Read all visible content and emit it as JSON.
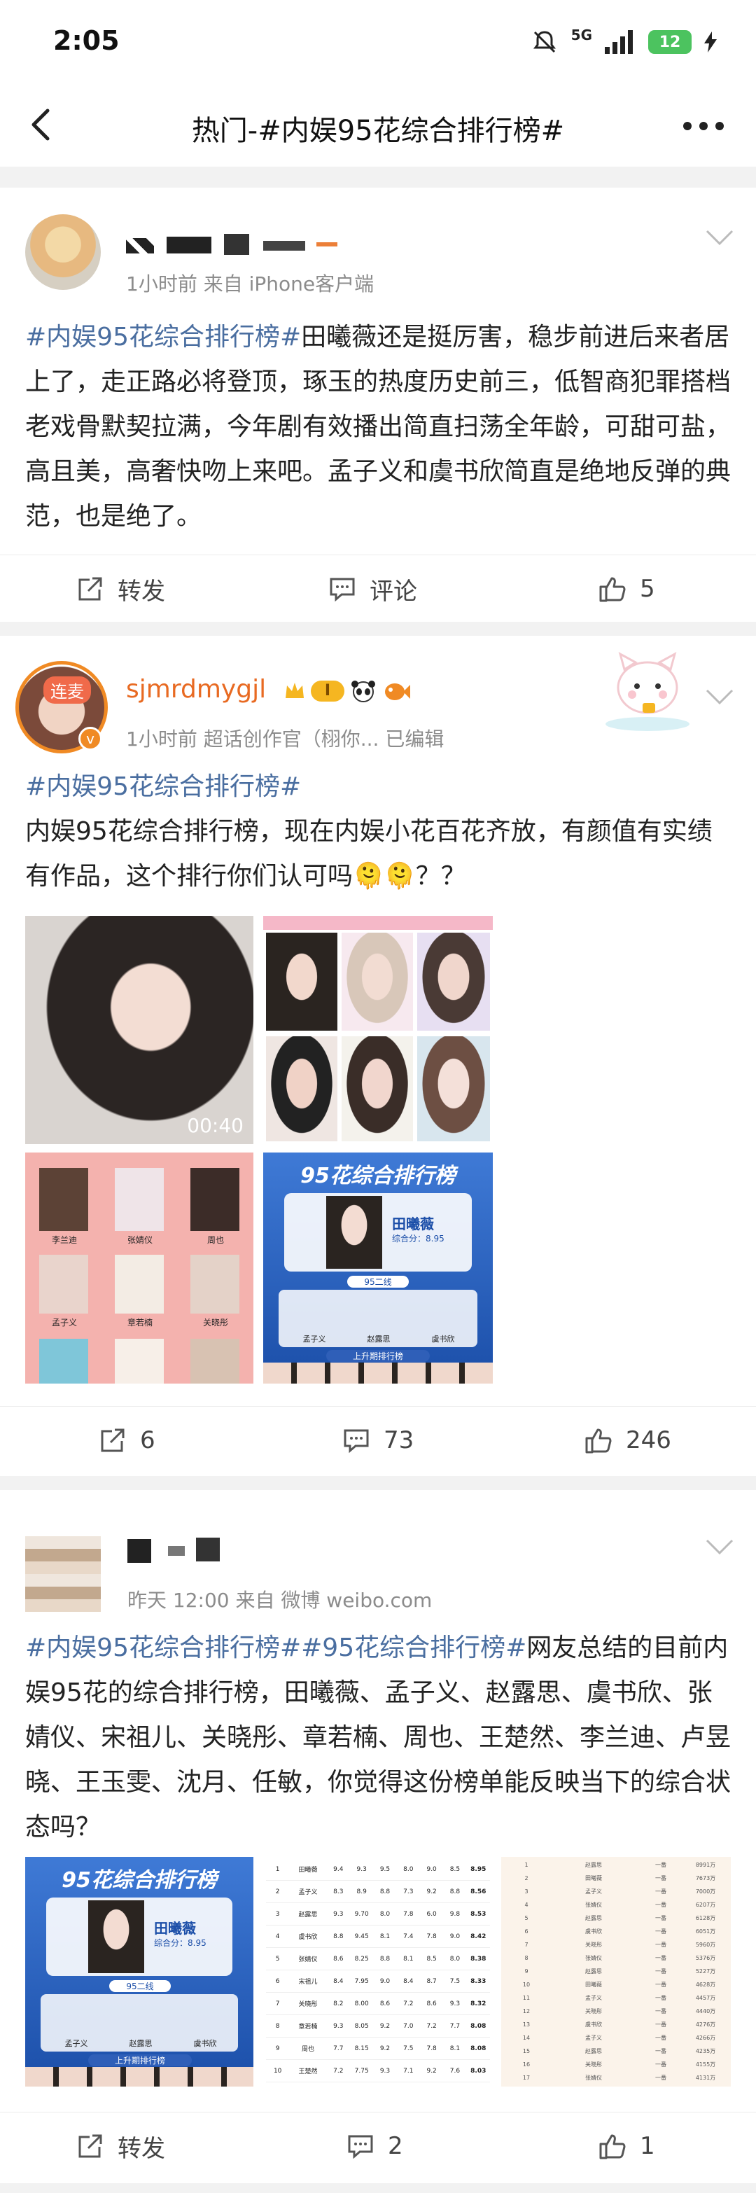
{
  "status": {
    "time": "2:05",
    "network": "5G",
    "battery": "12"
  },
  "nav": {
    "title": "热门-#内娱95花综合排行榜#"
  },
  "posts": [
    {
      "meta": "1小时前  来自 iPhone客户端",
      "text": {
        "tag": "#内娱95花综合排行榜#",
        "body": "田曦薇还是挺厉害，稳步前进后来者居上了，走正路必将登顶，琢玉的热度历史前三，低智商犯罪搭档老戏骨默契拉满，今年剧有效播出简直扫荡全年龄，可甜可盐，高且美，高奢快吻上来吧。孟子义和虞书欣简直是绝地反弹的典范，也是绝了。"
      },
      "actions": {
        "repost": "转发",
        "comment": "评论",
        "like": "5"
      }
    },
    {
      "username": "sjmrdmygjl",
      "avatar_badge": "连麦",
      "level_badge": "I",
      "meta": "1小时前  超话创作官（栩你...  已编辑",
      "text": {
        "tag": "#内娱95花综合排行榜#",
        "body": "内娱95花综合排行榜，现在内娱小花百花齐放，有颜值有实绩有作品，这个排行你们认可吗🫠🫠？？"
      },
      "images": {
        "video_duration": "00:40",
        "ranking_title": "95花综合排行榜",
        "ranking_top_name": "田曦薇",
        "ranking_top_score": "综合分：8.95",
        "ranking_tier": "95二线",
        "ranking_second_row": [
          "孟子义",
          "赵露思",
          "虞书欣"
        ],
        "ranking_footer": "上升期排行榜",
        "grid_names": [
          "李兰迪",
          "张婧仪",
          "周也",
          "孟子义",
          "章若楠",
          "关晓彤"
        ]
      },
      "actions": {
        "repost": "6",
        "comment": "73",
        "like": "246"
      }
    },
    {
      "meta": "昨天 12:00  来自 微博 weibo.com",
      "text": {
        "tags": "#内娱95花综合排行榜##95花综合排行榜#",
        "body": "网友总结的目前内娱95花的综合排行榜，田曦薇、孟子义、赵露思、虞书欣、张婧仪、宋祖儿、关晓彤、章若楠、周也、王楚然、李兰迪、卢昱晓、王玉雯、沈月、任敏，你觉得这份榜单能反映当下的综合状态吗？"
      },
      "images": {
        "ranking_title": "95花综合排行榜",
        "ranking_top_name": "田曦薇",
        "ranking_top_score": "综合分：8.95",
        "ranking_tier": "95二线",
        "ranking_second_row": [
          "孟子义",
          "赵露思",
          "虞书欣"
        ],
        "ranking_footer": "上升期排行榜",
        "table_rows": [
          {
            "rank": "1",
            "name": "田曦薇",
            "scores": [
              "9.4",
              "9.3",
              "9.5",
              "8.0",
              "9.0",
              "8.5"
            ],
            "total": "8.95"
          },
          {
            "rank": "2",
            "name": "孟子义",
            "scores": [
              "8.3",
              "8.9",
              "8.8",
              "7.3",
              "9.2",
              "8.8"
            ],
            "total": "8.56"
          },
          {
            "rank": "3",
            "name": "赵露思",
            "scores": [
              "9.3",
              "9.70",
              "8.0",
              "7.8",
              "6.0",
              "9.8"
            ],
            "total": "8.53"
          },
          {
            "rank": "4",
            "name": "虞书欣",
            "scores": [
              "8.8",
              "9.45",
              "8.1",
              "7.4",
              "7.8",
              "9.0"
            ],
            "total": "8.42"
          },
          {
            "rank": "5",
            "name": "张婧仪",
            "scores": [
              "8.6",
              "8.25",
              "8.8",
              "8.1",
              "8.5",
              "8.0"
            ],
            "total": "8.38"
          },
          {
            "rank": "6",
            "name": "宋祖儿",
            "scores": [
              "8.4",
              "7.95",
              "9.0",
              "8.4",
              "8.7",
              "7.5"
            ],
            "total": "8.33"
          },
          {
            "rank": "7",
            "name": "关晓彤",
            "scores": [
              "8.2",
              "8.00",
              "8.6",
              "7.2",
              "8.6",
              "9.3"
            ],
            "total": "8.32"
          },
          {
            "rank": "8",
            "name": "章若楠",
            "scores": [
              "9.3",
              "8.05",
              "9.2",
              "7.0",
              "7.2",
              "7.7"
            ],
            "total": "8.08"
          },
          {
            "rank": "9",
            "name": "周也",
            "scores": [
              "7.7",
              "8.15",
              "9.2",
              "7.5",
              "7.8",
              "8.1"
            ],
            "total": "8.08"
          },
          {
            "rank": "10",
            "name": "王楚然",
            "scores": [
              "7.2",
              "7.75",
              "9.3",
              "7.1",
              "9.2",
              "7.6"
            ],
            "total": "8.03"
          }
        ],
        "list_rows": [
          {
            "rank": "1",
            "name": "赵露思",
            "tier": "一番",
            "value": "8991万"
          },
          {
            "rank": "2",
            "name": "田曦薇",
            "tier": "一番",
            "value": "7673万"
          },
          {
            "rank": "3",
            "name": "孟子义",
            "tier": "一番",
            "value": "7000万"
          },
          {
            "rank": "4",
            "name": "张婧仪",
            "tier": "一番",
            "value": "6207万"
          },
          {
            "rank": "5",
            "name": "赵露思",
            "tier": "一番",
            "value": "6128万"
          },
          {
            "rank": "6",
            "name": "虞书欣",
            "tier": "一番",
            "value": "6051万"
          },
          {
            "rank": "7",
            "name": "关晓彤",
            "tier": "一番",
            "value": "5960万"
          },
          {
            "rank": "8",
            "name": "张婧仪",
            "tier": "一番",
            "value": "5376万"
          },
          {
            "rank": "9",
            "name": "赵露思",
            "tier": "一番",
            "value": "5227万"
          },
          {
            "rank": "10",
            "name": "田曦薇",
            "tier": "一番",
            "value": "4628万"
          },
          {
            "rank": "11",
            "name": "孟子义",
            "tier": "一番",
            "value": "4457万"
          },
          {
            "rank": "12",
            "name": "关晓彤",
            "tier": "一番",
            "value": "4440万"
          },
          {
            "rank": "13",
            "name": "虞书欣",
            "tier": "一番",
            "value": "4276万"
          },
          {
            "rank": "14",
            "name": "孟子义",
            "tier": "一番",
            "value": "4266万"
          },
          {
            "rank": "15",
            "name": "赵露思",
            "tier": "一番",
            "value": "4235万"
          },
          {
            "rank": "16",
            "name": "关晓彤",
            "tier": "一番",
            "value": "4155万"
          },
          {
            "rank": "17",
            "name": "张婧仪",
            "tier": "一番",
            "value": "4131万"
          }
        ]
      },
      "actions": {
        "repost": "转发",
        "comment": "2",
        "like": "1"
      }
    }
  ]
}
